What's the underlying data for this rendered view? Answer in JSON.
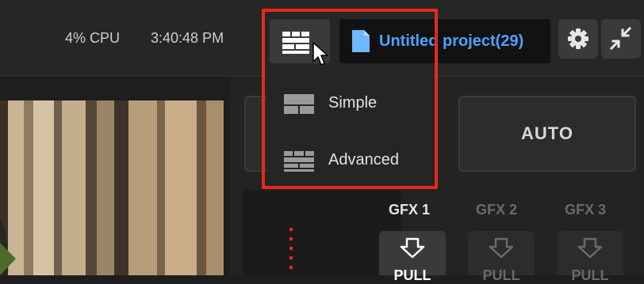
{
  "status": {
    "cpu": "4% CPU",
    "time": "3:40:48 PM"
  },
  "layout_button": {
    "icon": "layout-grid-icon"
  },
  "project": {
    "title": "Untitled project(29)",
    "icon": "document-icon"
  },
  "toolbar": {
    "settings_icon": "gear-icon",
    "collapse_icon": "collapse-arrows-icon"
  },
  "layout_menu": {
    "items": [
      {
        "label": "Simple",
        "icon": "simple-layout-icon"
      },
      {
        "label": "Advanced",
        "icon": "advanced-layout-icon"
      }
    ]
  },
  "transition": {
    "auto_label": "AUTO"
  },
  "gfx": {
    "channels": [
      {
        "label": "GFX 1",
        "action": "PULL",
        "active": true
      },
      {
        "label": "GFX 2",
        "action": "PULL",
        "active": false
      },
      {
        "label": "GFX 3",
        "action": "PULL",
        "active": false
      }
    ]
  },
  "colors": {
    "accent": "#4aa3ff",
    "highlight": "#e8281e",
    "background": "#1e1e1e"
  }
}
